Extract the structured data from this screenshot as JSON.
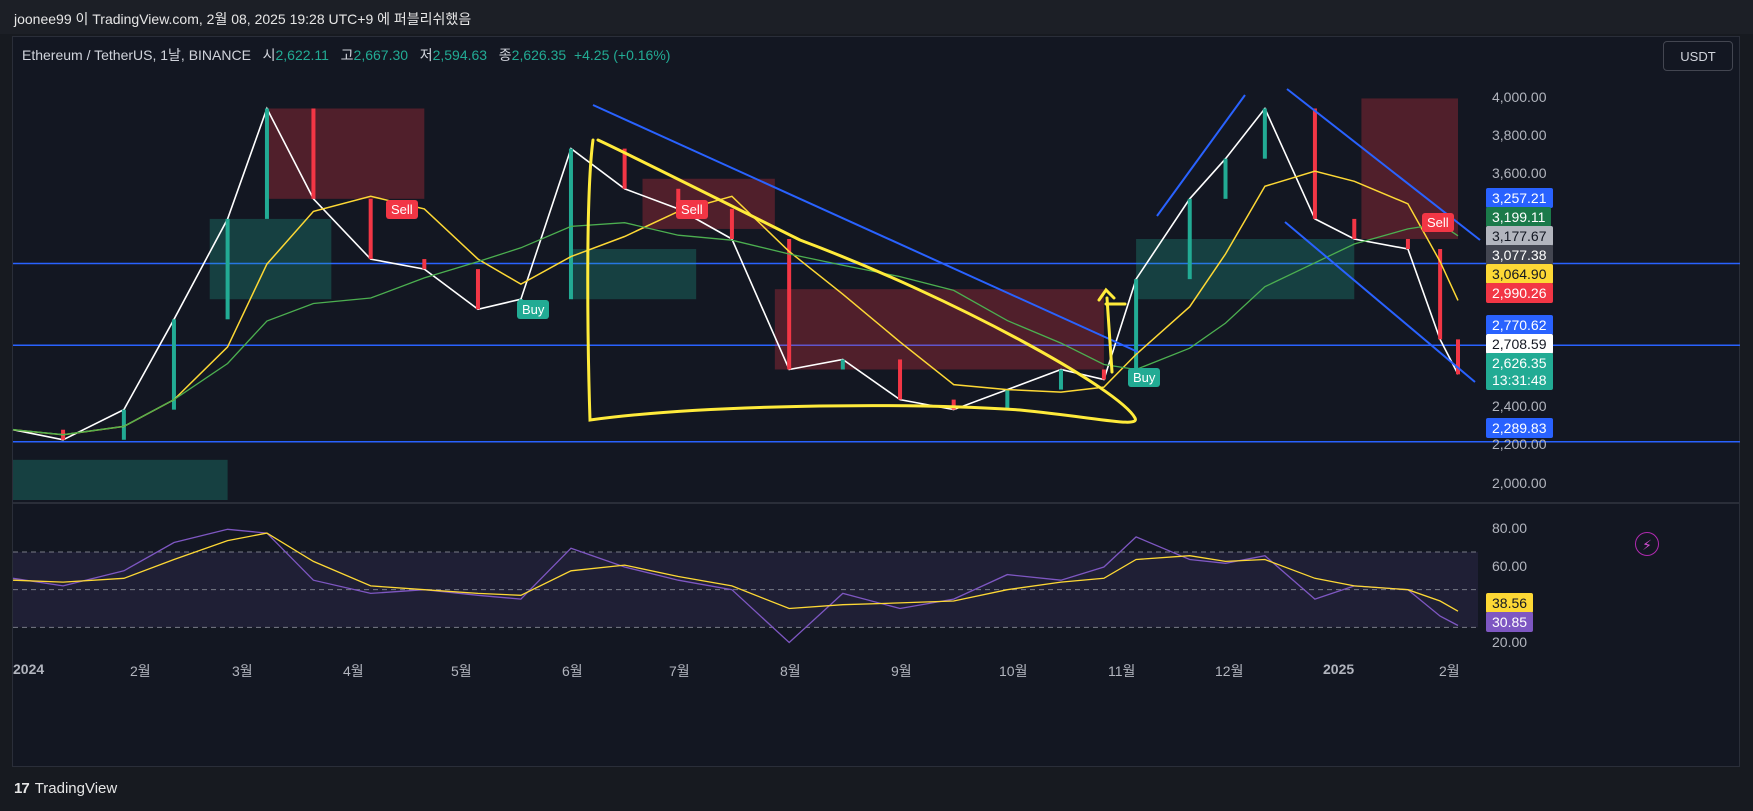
{
  "header": {
    "publish_text": "joonee99 이 TradingView.com, 2월 08, 2025 19:28 UTC+9 에 퍼블리쉬했음"
  },
  "symbol": {
    "name": "Ethereum / TetherUS, 1날, BINANCE",
    "open_label": "시",
    "open": "2,622.11",
    "high_label": "고",
    "high": "2,667.30",
    "low_label": "저",
    "low": "2,594.63",
    "close_label": "종",
    "close": "2,626.35",
    "change": "+4.25 (+0.16%)"
  },
  "currency_button": "USDT",
  "colors": {
    "background": "#131722",
    "up": "#22ab94",
    "down": "#f23645",
    "trendline": "#2962ff",
    "drawing": "#ffeb3b",
    "rsi": "#7e57c2",
    "rsi_ma": "#fdd835"
  },
  "price_axis": {
    "labels": [
      "4,000.00",
      "3,800.00",
      "3,600.00",
      "2,400.00",
      "2,200.00",
      "2,000.00"
    ]
  },
  "price_tags": [
    {
      "text": "3,257.21",
      "bg": "#2962ff",
      "fg": "#ffffff"
    },
    {
      "text": "3,199.11",
      "bg": "#1b7a4a",
      "fg": "#ffffff"
    },
    {
      "text": "3,177.67",
      "bg": "#b2b5be",
      "fg": "#131722"
    },
    {
      "text": "3,077.38",
      "bg": "#434651",
      "fg": "#ffffff"
    },
    {
      "text": "3,064.90",
      "bg": "#fdd835",
      "fg": "#131722"
    },
    {
      "text": "2,990.26",
      "bg": "#f23645",
      "fg": "#ffffff"
    },
    {
      "text": "2,770.62",
      "bg": "#2962ff",
      "fg": "#ffffff"
    },
    {
      "text": "2,708.59",
      "bg": "#ffffff",
      "fg": "#131722"
    },
    {
      "text": "2,626.35",
      "bg": "#22ab94",
      "fg": "#ffffff"
    },
    {
      "text": "13:31:48",
      "bg": "#22ab94",
      "fg": "#ffffff"
    },
    {
      "text": "2,289.83",
      "bg": "#2962ff",
      "fg": "#ffffff"
    }
  ],
  "rsi_axis": {
    "labels": [
      "80.00",
      "60.00",
      "20.00"
    ],
    "tags": [
      {
        "text": "38.56",
        "bg": "#fdd835",
        "fg": "#131722"
      },
      {
        "text": "30.85",
        "bg": "#7e57c2",
        "fg": "#ffffff"
      }
    ]
  },
  "time_axis": {
    "labels": [
      "2024",
      "2월",
      "3월",
      "4월",
      "5월",
      "6월",
      "7월",
      "8월",
      "9월",
      "10월",
      "11월",
      "12월",
      "2025",
      "2월"
    ]
  },
  "signals": [
    {
      "type": "sell",
      "label": "Sell"
    },
    {
      "type": "buy",
      "label": "Buy"
    },
    {
      "type": "sell",
      "label": "Sell"
    },
    {
      "type": "buy",
      "label": "Buy"
    },
    {
      "type": "sell",
      "label": "Sell"
    }
  ],
  "footer": {
    "logo_text": "TradingView",
    "logo_mark": "17"
  },
  "chart_data": {
    "type": "line",
    "title": "Ethereum / TetherUS, 1날, BINANCE",
    "x": [
      "2024-01-01",
      "2024-01-15",
      "2024-02-01",
      "2024-02-15",
      "2024-03-01",
      "2024-03-12",
      "2024-03-25",
      "2024-04-10",
      "2024-04-25",
      "2024-05-10",
      "2024-05-22",
      "2024-06-05",
      "2024-06-20",
      "2024-07-05",
      "2024-07-20",
      "2024-08-05",
      "2024-08-20",
      "2024-09-05",
      "2024-09-20",
      "2024-10-05",
      "2024-10-20",
      "2024-11-01",
      "2024-11-10",
      "2024-11-25",
      "2024-12-05",
      "2024-12-16",
      "2024-12-30",
      "2025-01-10",
      "2025-01-25",
      "2025-02-03",
      "2025-02-08"
    ],
    "series": [
      {
        "values": [
          2350,
          2300,
          2450,
          2900,
          3400,
          3950,
          3500,
          3200,
          3150,
          2950,
          3000,
          3750,
          3550,
          3450,
          3300,
          2650,
          2700,
          2500,
          2450,
          2550,
          2650,
          2600,
          3100,
          3500,
          3700,
          3950,
          3400,
          3300,
          3250,
          2800,
          2626
        ]
      }
    ],
    "horizontal_levels": [
      3177.67,
      2770.62,
      2289.83
    ],
    "ylim": [
      2000,
      4050
    ],
    "rsi": {
      "values": [
        56,
        52,
        60,
        75,
        82,
        80,
        55,
        48,
        50,
        47,
        45,
        72,
        62,
        55,
        50,
        22,
        48,
        40,
        45,
        58,
        55,
        62,
        78,
        66,
        64,
        68,
        45,
        52,
        50,
        36,
        31
      ],
      "ma_values": [
        55,
        54,
        56,
        66,
        76,
        80,
        65,
        52,
        50,
        48,
        47,
        60,
        63,
        57,
        52,
        40,
        42,
        43,
        44,
        50,
        54,
        56,
        66,
        68,
        65,
        66,
        56,
        52,
        50,
        44,
        38.56
      ],
      "ylim": [
        18,
        88
      ]
    }
  }
}
